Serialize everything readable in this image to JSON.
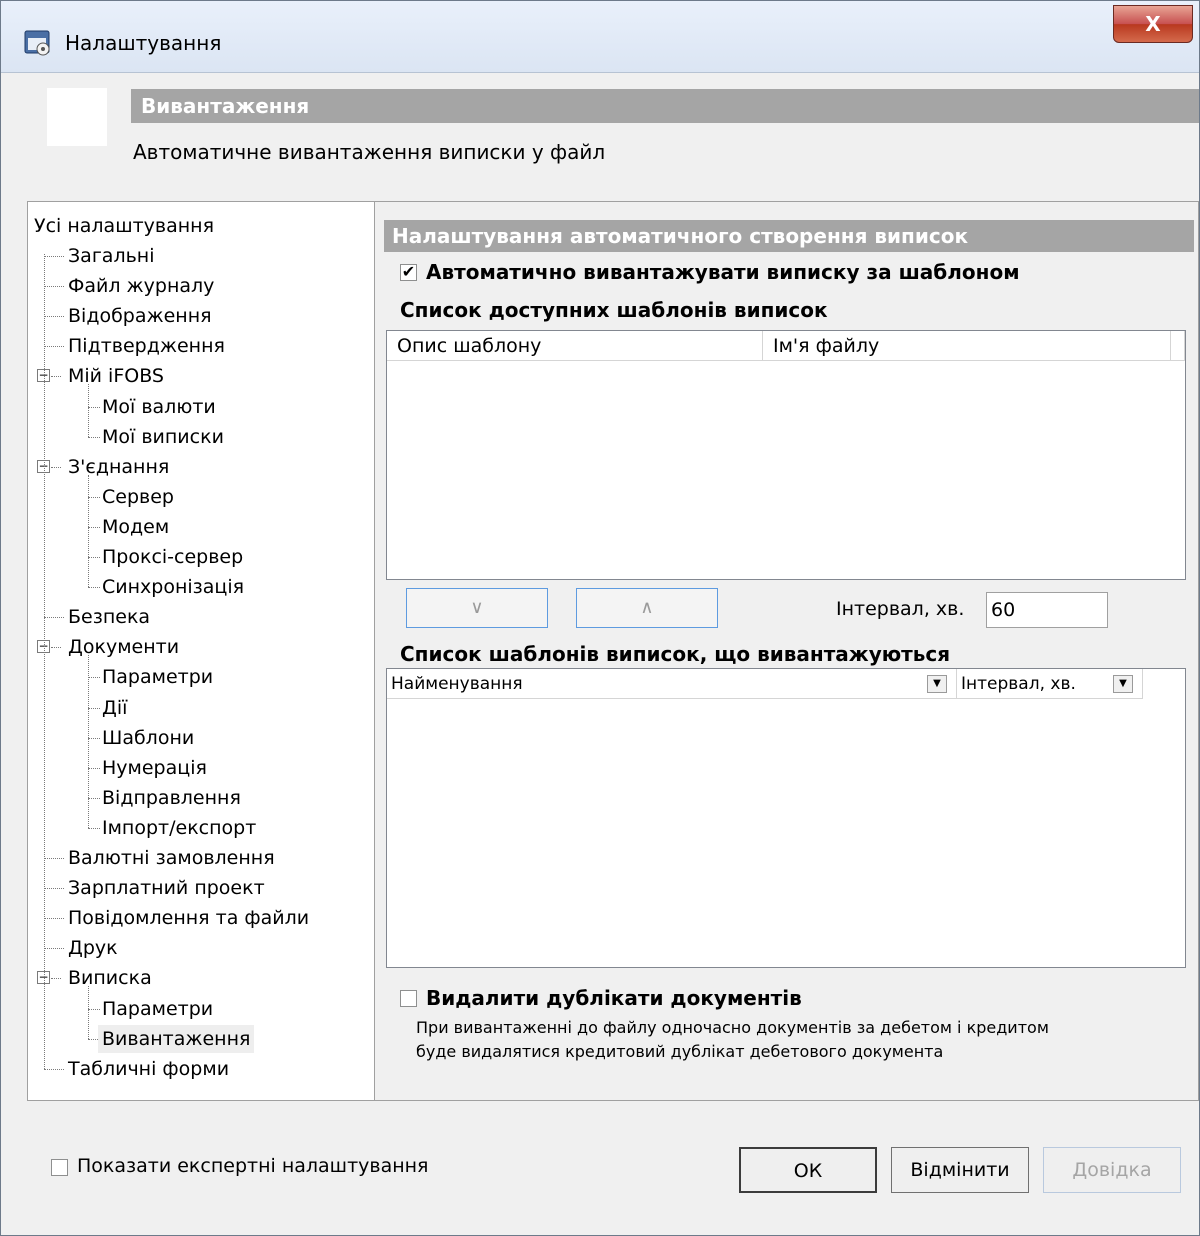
{
  "window": {
    "title": "Налаштування",
    "close_label": "X"
  },
  "header": {
    "title": "Вивантаження",
    "description": "Автоматичне вивантаження виписки у файл"
  },
  "tree": {
    "root": "Усі налаштування",
    "items": [
      {
        "label": "Загальні"
      },
      {
        "label": "Файл журналу"
      },
      {
        "label": "Відображення"
      },
      {
        "label": "Підтвердження"
      },
      {
        "label": "Мій iFOBS"
      },
      {
        "label": "Мої валюти"
      },
      {
        "label": "Мої виписки"
      },
      {
        "label": "З'єднання"
      },
      {
        "label": "Сервер"
      },
      {
        "label": "Модем"
      },
      {
        "label": "Проксі-сервер"
      },
      {
        "label": "Синхронізація"
      },
      {
        "label": "Безпека"
      },
      {
        "label": "Документи"
      },
      {
        "label": "Параметри"
      },
      {
        "label": "Дії"
      },
      {
        "label": "Шаблони"
      },
      {
        "label": "Нумерація"
      },
      {
        "label": "Відправлення"
      },
      {
        "label": "Імпорт/експорт"
      },
      {
        "label": "Валютні замовлення"
      },
      {
        "label": "Зарплатний проект"
      },
      {
        "label": "Повідомлення та файли"
      },
      {
        "label": "Друк"
      },
      {
        "label": "Виписка"
      },
      {
        "label": "Параметри"
      },
      {
        "label": "Вивантаження"
      },
      {
        "label": "Табличні форми"
      }
    ],
    "selected": "Вивантаження"
  },
  "pane": {
    "section_title": "Налаштування автоматичного створення виписок",
    "auto_export_label": "Автоматично вивантажувати виписку за шаблоном",
    "auto_export_checked": true,
    "auto_export_mark": "✔",
    "available_title": "Список доступних шаблонів виписок",
    "available_columns": [
      "Опис шаблону",
      "Ім'я файлу"
    ],
    "move_down": "∨",
    "move_up": "∧",
    "interval_label": "Інтервал, хв.",
    "interval_value": "60",
    "exported_title": "Список шаблонів виписок, що вивантажуються",
    "exported_columns": [
      "Найменування",
      "Інтервал, хв."
    ],
    "dropdown_arrow": "▼",
    "remove_dup_label": "Видалити дублікати документів",
    "remove_dup_checked": false,
    "remove_dup_desc_1": "При вивантаженні до файлу одночасно документів за дебетом і кредитом",
    "remove_dup_desc_2": "буде видалятися кредитовий дублікат дебетового документа"
  },
  "footer": {
    "expert_label": "Показати експертні налаштування",
    "ok": "ОК",
    "cancel": "Відмінити",
    "help": "Довідка"
  }
}
